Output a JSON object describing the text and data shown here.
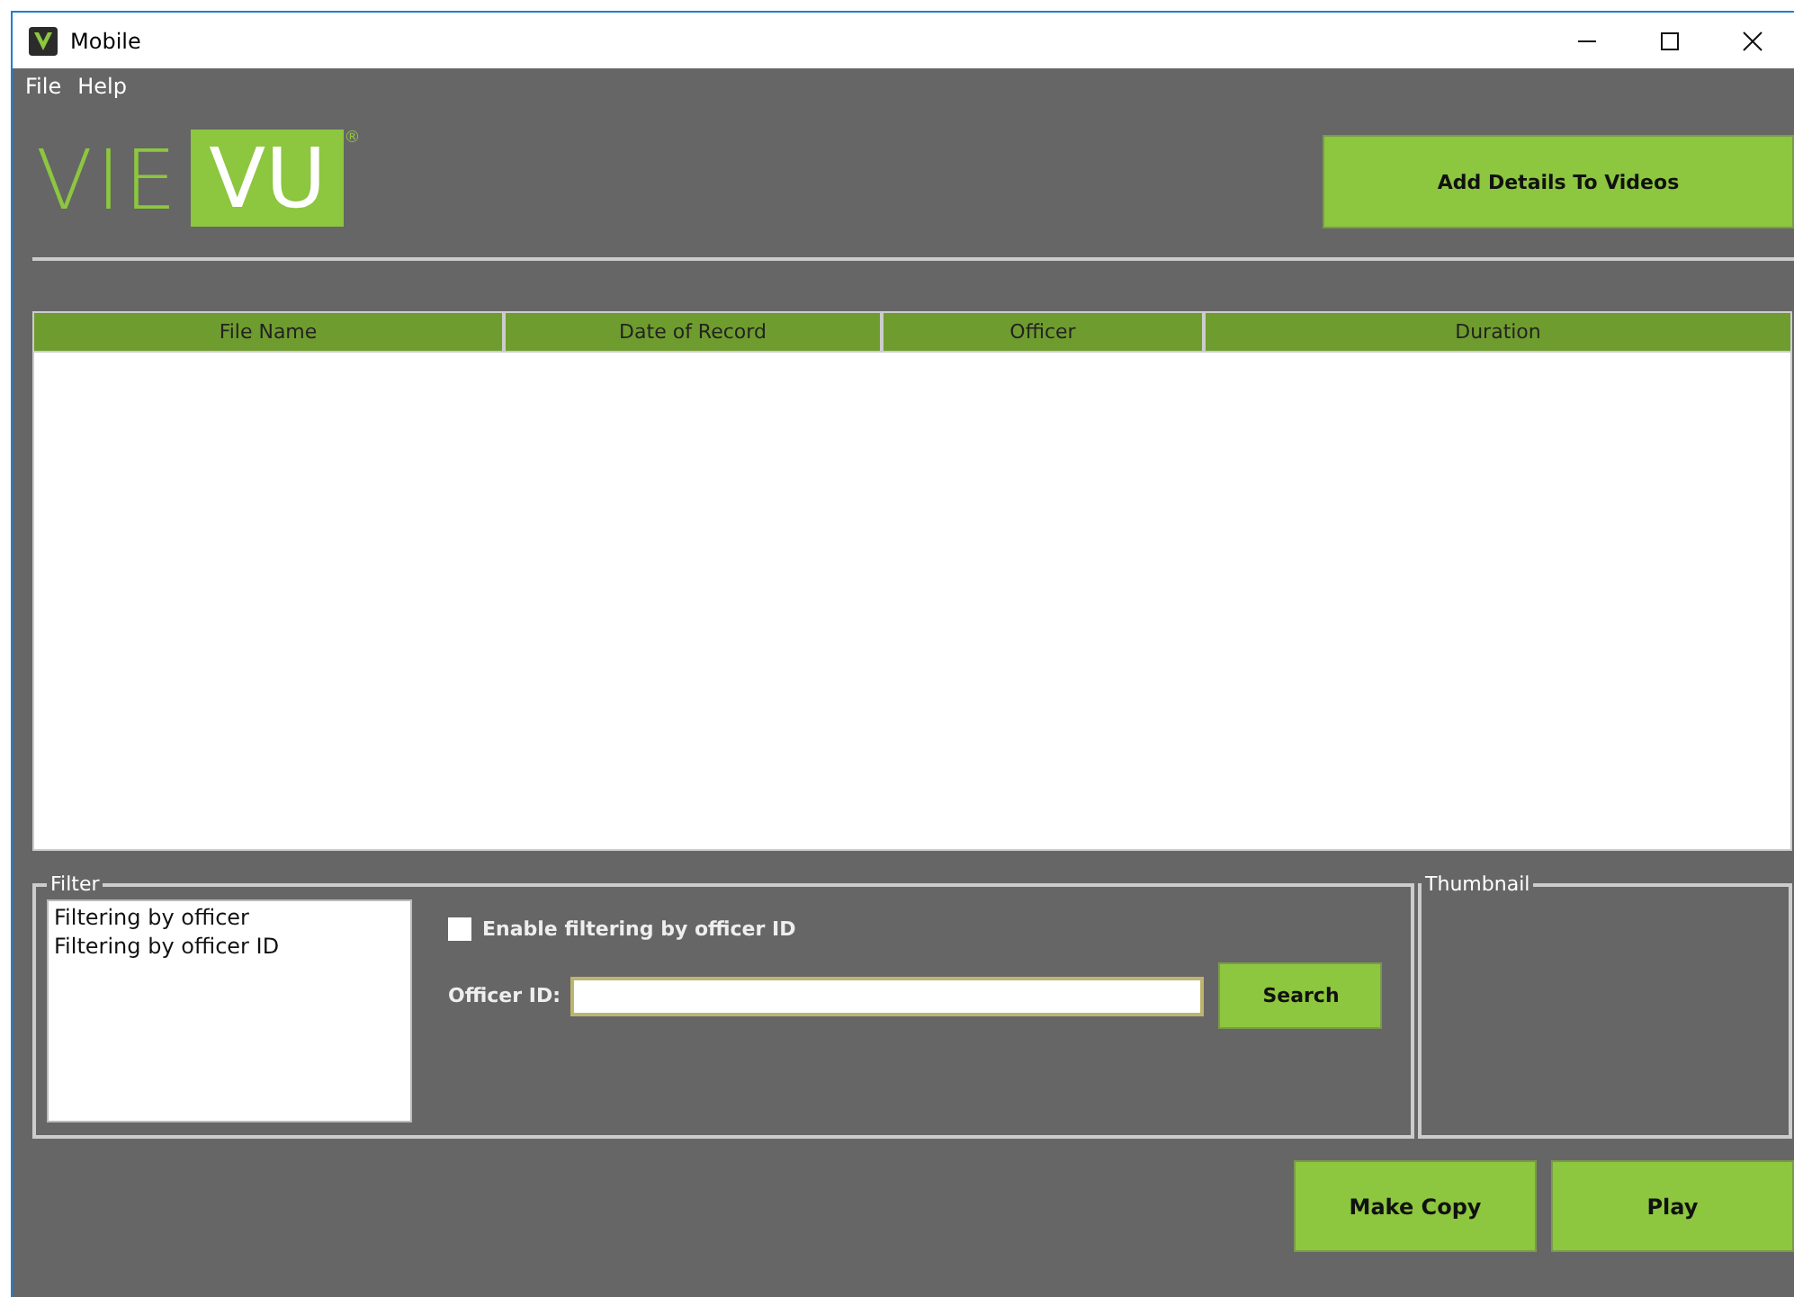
{
  "window": {
    "title": "Mobile"
  },
  "menu": [
    "File",
    "Help"
  ],
  "logo": {
    "left": "VIE",
    "right": "VU",
    "mark": "®"
  },
  "add_button": "Add Details To Videos",
  "table": {
    "columns": [
      "File Name",
      "Date of Record",
      "Officer",
      "Duration"
    ]
  },
  "filter": {
    "title": "Filter",
    "options": [
      "Filtering by officer",
      "Filtering by officer ID"
    ],
    "enable": {
      "label": "Enable filtering by officer ID",
      "checked": false
    },
    "officer_label": "Officer ID:",
    "search_button": "Search"
  },
  "thumbnail": {
    "title": "Thumbnail"
  },
  "buttons": [
    "Make Copy",
    "Play"
  ]
}
